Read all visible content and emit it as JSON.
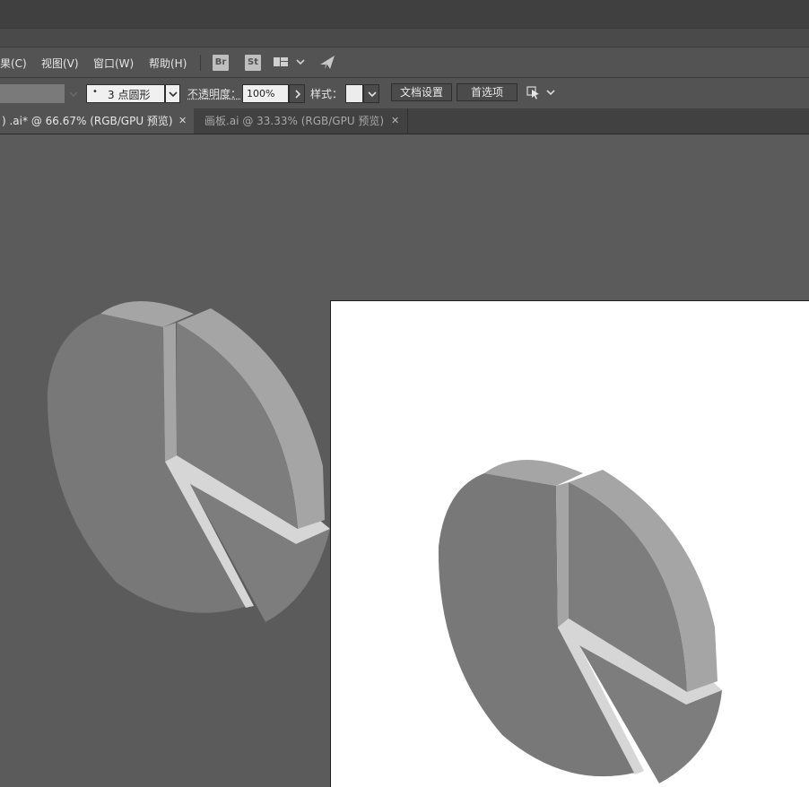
{
  "menu": {
    "items": [
      "果(C)",
      "视图(V)",
      "窗口(W)",
      "帮助(H)"
    ],
    "bridge_label": "Br",
    "stock_label": "St"
  },
  "control": {
    "brush_value": "3 点圆形",
    "opacity_label": "不透明度：",
    "opacity_value": "100%",
    "style_label": "样式：",
    "doc_settings_label": "文档设置",
    "preferences_label": "首选项"
  },
  "tabs": [
    {
      "label": ") .ai* @ 66.67% (RGB/GPU 预览)",
      "active": true
    },
    {
      "label": "画板.ai @ 33.33% (RGB/GPU 预览)",
      "active": false
    }
  ],
  "colors": {
    "canvas": "#5b5b5b",
    "artboard": "#ffffff",
    "pie_top": "#787878",
    "pie_side": "#a5a5a5",
    "pie_gap": "#d6d6d6"
  },
  "icons": {
    "workspace": "workspace-layout-icon",
    "publish": "paper-plane-icon",
    "arrange": "arrange-icon",
    "close": "close-icon",
    "dropdown": "chevron-down-icon"
  }
}
